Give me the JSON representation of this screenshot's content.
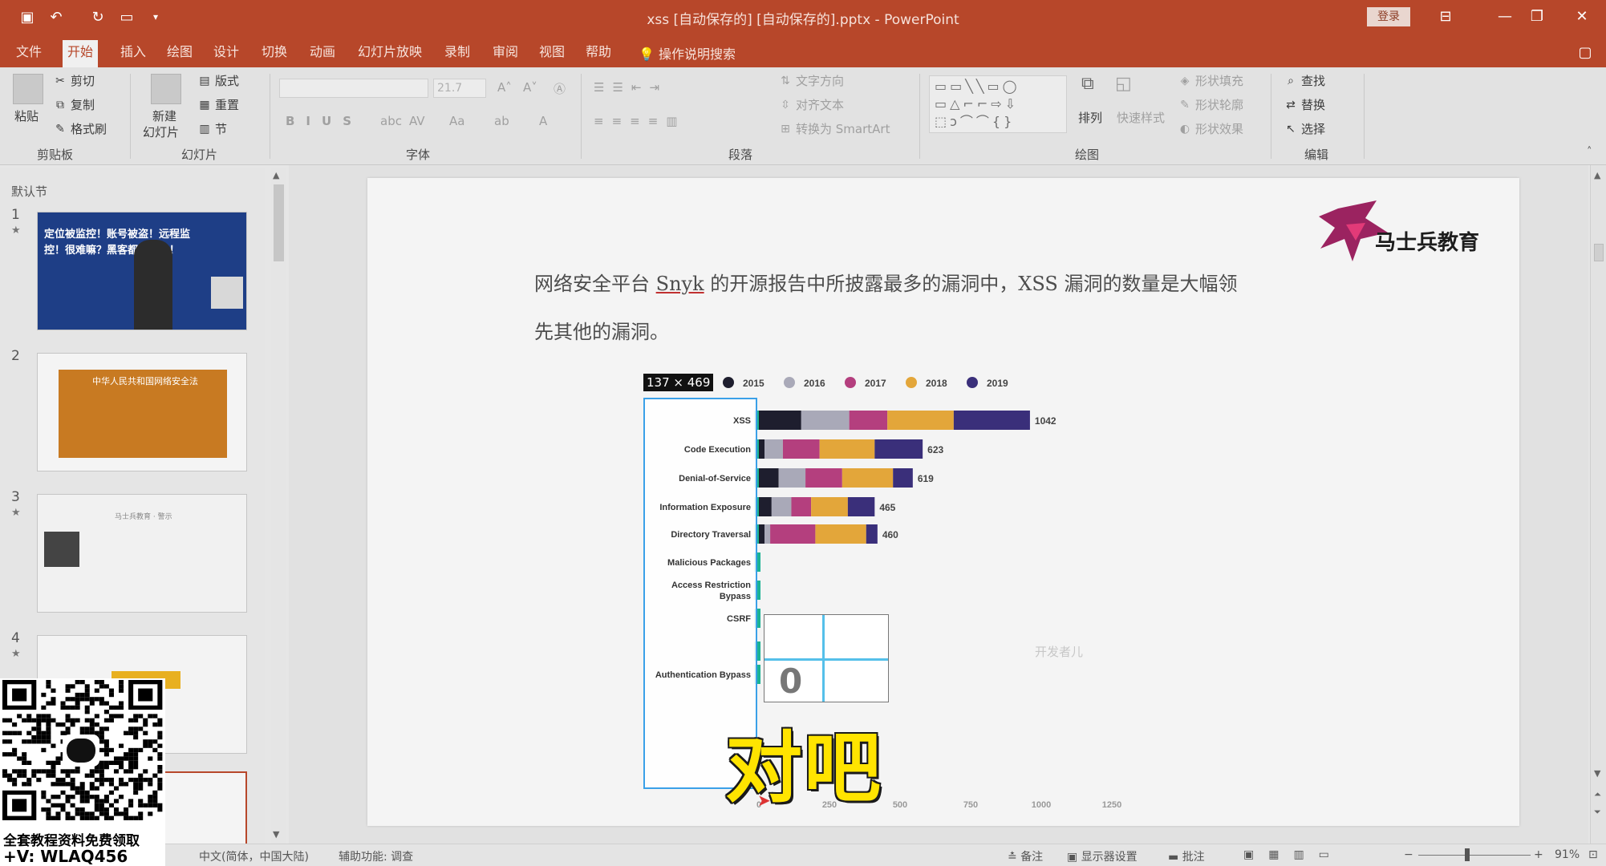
{
  "window": {
    "title": "xss [自动保存的] [自动保存的].pptx  -  PowerPoint",
    "login": "登录"
  },
  "menu": {
    "tabs": [
      "文件",
      "开始",
      "插入",
      "绘图",
      "设计",
      "切换",
      "动画",
      "幻灯片放映",
      "录制",
      "审阅",
      "视图",
      "帮助"
    ],
    "search": "操作说明搜索"
  },
  "ribbon": {
    "clipboard": {
      "paste": "粘贴",
      "cut": "剪切",
      "copy": "复制",
      "format_painter": "格式刷",
      "label": "剪贴板"
    },
    "slides": {
      "new_slide_line1": "新建",
      "new_slide_line2": "幻灯片",
      "layout": "版式",
      "reset": "重置",
      "section": "节",
      "label": "幻灯片"
    },
    "font": {
      "size": "21.7",
      "label": "字体"
    },
    "paragraph": {
      "text_direction": "文字方向",
      "align_text": "对齐文本",
      "smartart": "转换为 SmartArt",
      "label": "段落"
    },
    "drawing": {
      "arrange": "排列",
      "quick_styles": "快速样式",
      "fill": "形状填充",
      "outline": "形状轮廓",
      "effects": "形状效果",
      "label": "绘图"
    },
    "editing": {
      "find": "查找",
      "replace": "替换",
      "select": "选择",
      "label": "编辑"
    }
  },
  "thumbnails": {
    "section": "默认节",
    "slides": [
      {
        "num": "1",
        "star": "★",
        "title": "定位被监控！账号被盗！远程监控！很难嘛？黑客都杀疯了！"
      },
      {
        "num": "2",
        "star": "",
        "title": "中华人民共和国网络安全法"
      },
      {
        "num": "3",
        "star": "★",
        "title": "马士兵教育 · 警示"
      },
      {
        "num": "4",
        "star": "★",
        "title": ""
      }
    ]
  },
  "slide": {
    "text_line1_pre": "网络安全平台 ",
    "text_link": "Snyk",
    "text_line1_post": " 的开源报告中所披露最多的漏洞中，XSS 漏洞的数量是大幅领",
    "text_line2": "先其他的漏洞。",
    "brand": "马士兵教育",
    "selection_size": "137 × 469",
    "watermark": "开发者儿"
  },
  "chart_data": {
    "type": "bar",
    "orientation": "horizontal-stacked",
    "categories": [
      "XSS",
      "Code Execution",
      "Denial-of-Service",
      "Information Exposure",
      "Directory Traversal",
      "Malicious Packages",
      "Access Restriction Bypass",
      "CSRF",
      "",
      "Authentication Bypass"
    ],
    "totals": [
      1042,
      623,
      619,
      465,
      460,
      null,
      null,
      null,
      null,
      null
    ],
    "legend": [
      "2015",
      "2016",
      "2017",
      "2018",
      "2019"
    ],
    "colors": {
      "2014": "#1bb394",
      "2015": "#1e1e2e",
      "2016": "#a9a9b8",
      "2017": "#b43f7e",
      "2018": "#e3a63a",
      "2019": "#3a2f7a"
    },
    "series": [
      {
        "name": "2015",
        "values": [
          150,
          20,
          70,
          45,
          20
        ]
      },
      {
        "name": "2016",
        "values": [
          170,
          65,
          95,
          70,
          20
        ]
      },
      {
        "name": "2017",
        "values": [
          135,
          130,
          130,
          70,
          160
        ]
      },
      {
        "name": "2018",
        "values": [
          235,
          195,
          180,
          130,
          180
        ]
      },
      {
        "name": "2019",
        "values": [
          270,
          170,
          70,
          95,
          40
        ]
      }
    ],
    "x_ticks": [
      "0",
      "250",
      "500",
      "750",
      "1000",
      "1250"
    ],
    "xlim": [
      0,
      1250
    ]
  },
  "overlay": {
    "subtitle": "对吧",
    "qr_caption_1": "全套教程资料免费领取",
    "qr_caption_2": "+V: WLAQ456",
    "magnifier_digit": "0"
  },
  "status": {
    "language": "中文(简体，中国大陆)",
    "accessibility": "辅助功能: 调查",
    "notes": "备注",
    "display": "显示器设置",
    "comments": "批注",
    "zoom": "91%"
  }
}
